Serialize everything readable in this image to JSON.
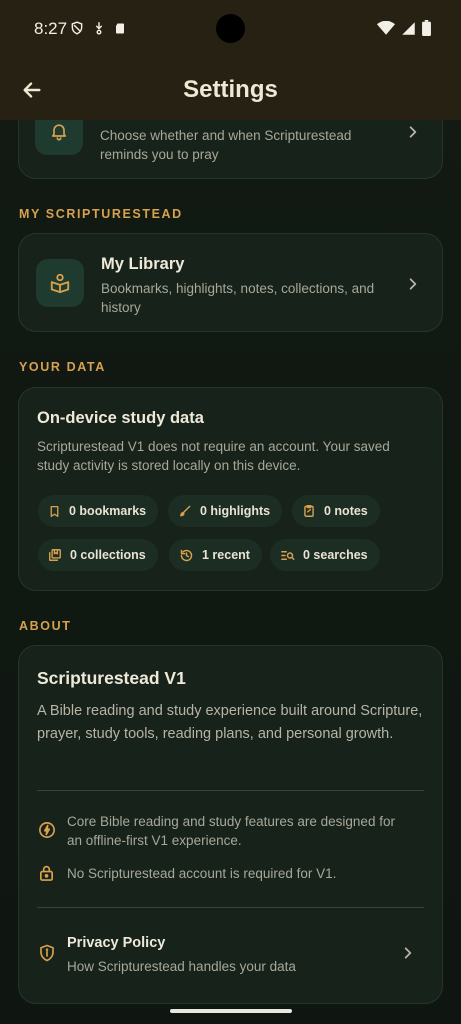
{
  "status_bar": {
    "time": "8:27"
  },
  "app_bar": {
    "title": "Settings"
  },
  "reminders": {
    "subtitle": "Choose whether and when Scripturestead reminds you to pray"
  },
  "sections": {
    "my": "MY SCRIPTURESTEAD",
    "data": "YOUR DATA",
    "about": "ABOUT"
  },
  "library": {
    "title": "My Library",
    "subtitle": "Bookmarks, highlights, notes, collections, and history"
  },
  "data_card": {
    "title": "On-device study data",
    "description": "Scripturestead V1 does not require an account. Your saved study activity is stored locally on this device.",
    "chips": [
      {
        "label": "0 bookmarks",
        "icon": "bookmark-icon"
      },
      {
        "label": "0 highlights",
        "icon": "brush-icon"
      },
      {
        "label": "0 notes",
        "icon": "note-icon"
      },
      {
        "label": "0 collections",
        "icon": "collections-icon"
      },
      {
        "label": "1 recent",
        "icon": "history-icon"
      },
      {
        "label": "0 searches",
        "icon": "search-list-icon"
      }
    ]
  },
  "about_card": {
    "title": "Scripturestead V1",
    "description": "A Bible reading and study experience built around Scripture, prayer, study tools, reading plans, and personal growth.",
    "features": [
      {
        "text": "Core Bible reading and study features are designed for an offline-first V1 experience.",
        "icon": "bolt-icon"
      },
      {
        "text": "No Scripturestead account is required for V1.",
        "icon": "lock-icon"
      }
    ],
    "privacy": {
      "title": "Privacy Policy",
      "subtitle": "How Scripturestead handles your data"
    }
  },
  "colors": {
    "accent": "#d7a14d",
    "card": "#17221b",
    "chip": "#1c2d24",
    "appbar": "#272114"
  }
}
